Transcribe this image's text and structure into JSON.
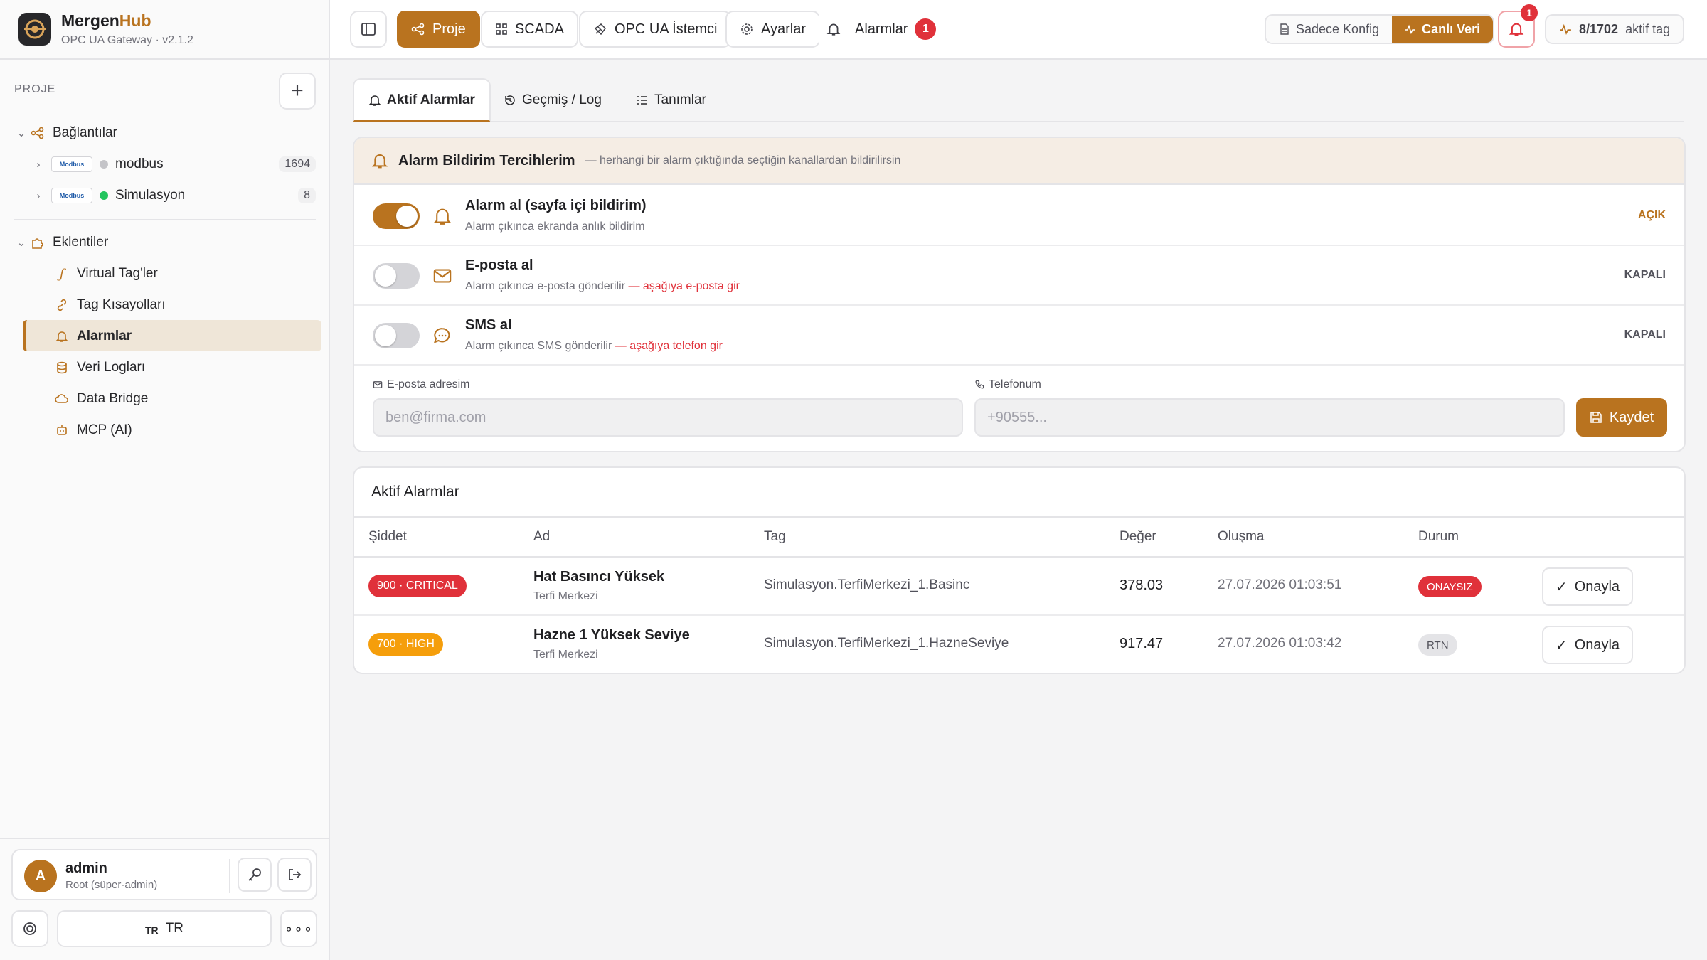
{
  "app": {
    "name_part1": "Mergen",
    "name_part2": "Hub",
    "subtitle": "OPC UA Gateway · v2.1.2"
  },
  "sidebar": {
    "section_label": "PROJE",
    "add_label": "+",
    "connections_label": "Bağlantılar",
    "connections": [
      {
        "logo_text": "Modbus",
        "name": "modbus",
        "count": "1694",
        "status": "idle"
      },
      {
        "logo_text": "Modbus",
        "name": "Simulasyon",
        "count": "8",
        "status": "online"
      }
    ],
    "plugins_label": "Eklentiler",
    "plugins": [
      {
        "label": "Virtual Tag'ler",
        "icon": "function-icon"
      },
      {
        "label": "Tag Kısayolları",
        "icon": "link-icon"
      },
      {
        "label": "Alarmlar",
        "icon": "bell-icon",
        "active": true
      },
      {
        "label": "Veri Logları",
        "icon": "database-icon"
      },
      {
        "label": "Data Bridge",
        "icon": "cloud-icon"
      },
      {
        "label": "MCP (AI)",
        "icon": "robot-icon"
      }
    ],
    "user": {
      "initial": "A",
      "name": "admin",
      "role": "Root (süper-admin)"
    },
    "lang_short": "TR",
    "lang_label": "TR"
  },
  "topbar": {
    "proje": "Proje",
    "scada": "SCADA",
    "opc_client": "OPC UA İstemci",
    "settings": "Ayarlar",
    "alarms": "Alarmlar",
    "alarms_count": "1",
    "mode_config": "Sadece Konfig",
    "mode_live": "Canlı Veri",
    "bell_count": "1",
    "tag_active": "8/1702",
    "tag_suffix": "aktif tag"
  },
  "tabs": {
    "active": "Aktif Alarmlar",
    "history": "Geçmiş / Log",
    "definitions": "Tanımlar"
  },
  "prefs": {
    "title": "Alarm Bildirim Tercihlerim",
    "desc": "— herhangi bir alarm çıktığında seçtiğin kanallardan bildirilirsin",
    "items": [
      {
        "title": "Alarm al (sayfa içi bildirim)",
        "sub": "Alarm çıkınca ekranda anlık bildirim",
        "warn": "",
        "state": "AÇIK",
        "on": true
      },
      {
        "title": "E-posta al",
        "sub": "Alarm çıkınca e-posta gönderilir",
        "warn": "— aşağıya e-posta gir",
        "state": "KAPALI",
        "on": false
      },
      {
        "title": "SMS al",
        "sub": "Alarm çıkınca SMS gönderilir",
        "warn": "— aşağıya telefon gir",
        "state": "KAPALI",
        "on": false
      }
    ],
    "email_label": "E-posta adresim",
    "email_placeholder": "ben@firma.com",
    "email_value": "",
    "phone_label": "Telefonum",
    "phone_placeholder": "+90555...",
    "phone_value": "",
    "save": "Kaydet"
  },
  "alarms": {
    "title": "Aktif Alarmlar",
    "columns": [
      "Şiddet",
      "Ad",
      "Tag",
      "Değer",
      "Oluşma",
      "Durum"
    ],
    "rows": [
      {
        "severity": "900 · CRITICAL",
        "sev_color": "#e0313a",
        "name": "Hat Basıncı Yüksek",
        "group": "Terfi Merkezi",
        "tag": "Simulasyon.TerfiMerkezi_1.Basinc",
        "value": "378.03",
        "time": "27.07.2026 01:03:51",
        "status": "ONAYSIZ",
        "ack": "Onayla"
      },
      {
        "severity": "700 · HIGH",
        "sev_color": "#f59e0b",
        "name": "Hazne 1 Yüksek Seviye",
        "group": "Terfi Merkezi",
        "tag": "Simulasyon.TerfiMerkezi_1.HazneSeviye",
        "value": "917.47",
        "time": "27.07.2026 01:03:42",
        "status": "RTN",
        "ack": "Onayla"
      }
    ]
  },
  "colors": {
    "accent": "#b9731f",
    "danger": "#e0313a",
    "warning": "#f59e0b",
    "online": "#22c55e",
    "idle": "#a1a1aa"
  }
}
